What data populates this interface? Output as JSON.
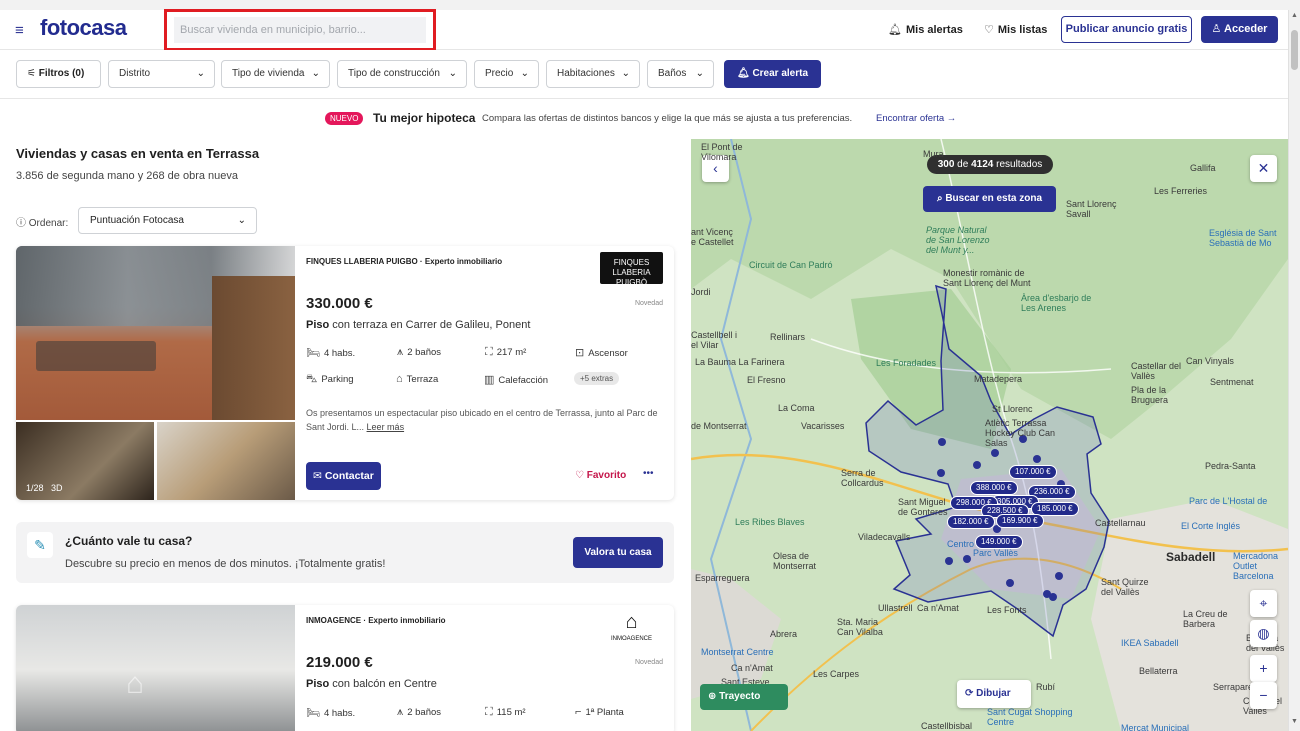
{
  "header": {
    "logo": "fotocasa",
    "search_placeholder": "Buscar vivienda en municipio, barrio...",
    "alerts": "Mis alertas",
    "lists": "Mis listas",
    "publish": "Publicar anuncio gratis",
    "login": "Acceder"
  },
  "filters": {
    "filtros": "Filtros (0)",
    "distrito": "Distrito",
    "tipo_vivienda": "Tipo de vivienda",
    "tipo_construccion": "Tipo de construcción",
    "precio": "Precio",
    "habitaciones": "Habitaciones",
    "banos": "Baños",
    "crear_alerta": "Crear alerta"
  },
  "promo": {
    "badge": "NUEVO",
    "title": "Tu mejor hipoteca",
    "text": "Compara las ofertas de distintos bancos y elige la que más se ajusta a tus preferencias.",
    "link": "Encontrar oferta →"
  },
  "results": {
    "title": "Viviendas y casas en venta en Terrassa",
    "subtitle": "3.856 de segunda mano y 268 de obra nueva",
    "order_label": "Ordenar:",
    "order_value": "Puntuación Fotocasa"
  },
  "listings": [
    {
      "agency": "FINQUES LLABERIA PUIGBO · Experto inmobiliario",
      "agency_logo": "FINQUES LLABERIA PUIGBÒ",
      "novedad": "Novedad",
      "price": "330.000 €",
      "type": "Piso",
      "rest": " con terraza en Carrer de Galileu, Ponent",
      "features": [
        "4 habs.",
        "2 baños",
        "217 m²",
        "Ascensor",
        "Parking",
        "Terraza",
        "Calefacción"
      ],
      "extras": "+5 extras",
      "description": "Os presentamos un espectacular piso ubicado en el centro de Terrassa, junto al Parc de Sant Jordi. L...",
      "read_more": "Leer más",
      "photo_count": "1/28",
      "photo_3d": "3D",
      "contact": "Contactar",
      "favorite": "Favorito"
    },
    {
      "agency": "INMOAGENCE · Experto inmobiliario",
      "agency_logo": "INMOAGENCE",
      "novedad": "Novedad",
      "price": "219.000 €",
      "type": "Piso",
      "rest": " con balcón en Centre",
      "features": [
        "4 habs.",
        "2 baños",
        "115 m²",
        "1ª Planta"
      ]
    }
  ],
  "valuation": {
    "title": "¿Cuánto vale tu casa?",
    "text": "Descubre su precio en menos de dos minutos. ¡Totalmente gratis!",
    "button": "Valora tu casa"
  },
  "map": {
    "count_prefix": "300",
    "count_mid": " de ",
    "count_total": "4124",
    "count_suffix": " resultados",
    "search_zone": "Buscar en esta zona",
    "trayecto": "Trayecto",
    "dibujar": "Dibujar",
    "places": {
      "el_pont": "El Pont de",
      "vilomara": "Vilomara",
      "mura": "Mura",
      "gallifa": "Gallifa",
      "ferreries": "Les Ferreries",
      "sant_llorenc_savall": "Sant Llorenç Savall",
      "castellet": "e Castellet",
      "vicenc": "ant Vicenç",
      "circuit": "Circuit de Can Padró",
      "natural1": "Parque Natural de San Lorenzo del Munt y...",
      "monestir": "Monestir romànic de Sant Llorenç del Munt",
      "area": "Àrea d'esbarjo de Les Arenes",
      "jordi": "Jordi",
      "castellbell": "Castellbell i el Vilar",
      "rellinars": "Rellinars",
      "farinera": "La Bauma La Farinera",
      "fresno": "El Fresno",
      "foradades": "Les Foradades",
      "matadepera": "Matadepera",
      "castellar": "Castellar del Vallès",
      "pla": "Pla de la Bruguera",
      "can_vinyals": "Can Vinyals",
      "sentmenat": "Sentmenat",
      "montserrat": "de Montserrat",
      "la_coma": "La Coma",
      "vacarisses": "Vacarisses",
      "llorenc": "St Llorenc",
      "hockey": "Atlètic Terrassa Hockey Club Can Salas",
      "serra": "Serra de Collcardus",
      "pedra": "Pedra-Santa",
      "sant_miquel": "Sant Miguel de Gonteres",
      "ribes": "Les Ribes Blaves",
      "viladecavalls": "Viladecavalls",
      "castellarnau": "Castellarnau",
      "sabadell": "Sabadell",
      "parc": "Parc de L'Hostal de",
      "corte": "El Corte Inglés",
      "mercadona": "Mercadona Outlet Barcelona",
      "olesa": "Olesa de Montserrat",
      "esparreguera": "Esparreguera",
      "ullastrell": "Ullastrell",
      "can_amat1": "Ca n'Amat",
      "sant_quirze": "Sant Quirze del Vallès",
      "la_creu": "La Creu de Barbera",
      "barbera": "Barberà del Vallès",
      "abrera": "Abrera",
      "vilalba": "Sta. Maria Can Vilalba",
      "montserrat_centre": "Montserrat Centre",
      "can_amat2": "Ca n'Amat",
      "carpes": "Les Carpes",
      "ikea": "IKEA Sabadell",
      "bellaterra": "Bellaterra",
      "serraparera": "Serraparera",
      "cerda": "Cerda del Vallès",
      "rubi": "Rubí",
      "sant_esteve": "Sant Esteve",
      "cugat_shopping": "Sant Cugat Shopping Centre",
      "mercat": "Mercat Municipal",
      "castellbisbal": "Castellbisbal",
      "centro": "Centro",
      "parc_valles": "Parc Vallès",
      "les_fonts": "Les Fonts",
      "esglesia": "Església de Sant Sebastià de Mo"
    },
    "prices": [
      "107.000 €",
      "388.000 €",
      "236.000 €",
      "298.000 €",
      "228.500 €",
      "185.000 €",
      "182.000 €",
      "169.900 €",
      "149.000 €",
      "305.000 €"
    ]
  },
  "icons": {
    "menu": "hamburger-icon",
    "bell": "bell-icon",
    "heart": "heart-icon",
    "user": "user-icon",
    "filter": "sliders-icon",
    "alert": "alert-icon",
    "clock": "clock-icon",
    "map_close": "close-icon"
  }
}
